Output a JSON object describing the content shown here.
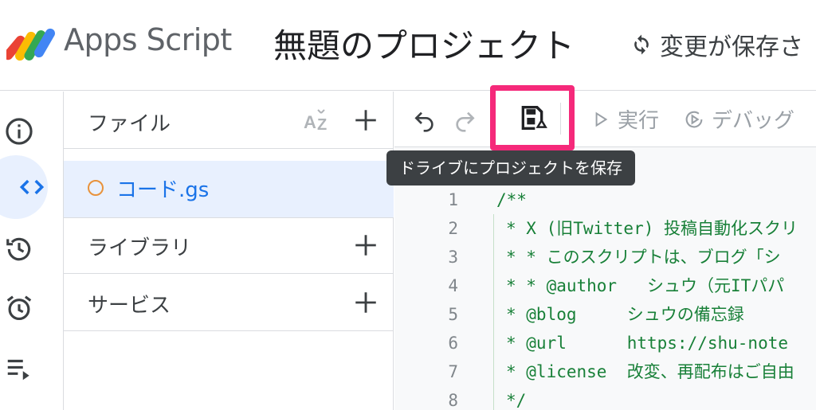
{
  "header": {
    "app_name": "Apps Script",
    "project_title": "無題のプロジェクト",
    "save_status": "変更が保存さ"
  },
  "rail": {
    "items": [
      {
        "icon": "info-icon"
      },
      {
        "icon": "code-icon",
        "active": true
      },
      {
        "icon": "history-icon"
      },
      {
        "icon": "alarm-icon"
      },
      {
        "icon": "executions-icon"
      }
    ]
  },
  "files": {
    "section_label": "ファイル",
    "file_name": "コード.gs",
    "libraries_label": "ライブラリ",
    "services_label": "サービス"
  },
  "toolbar": {
    "run_label": "実行",
    "debug_label": "デバッグ",
    "tooltip": "ドライブにプロジェクトを保存"
  },
  "code": {
    "lines": [
      {
        "n": "1",
        "text": "/**"
      },
      {
        "n": "2",
        "text": "* X (旧Twitter) 投稿自動化スクリ"
      },
      {
        "n": "3",
        "text": "* * このスクリプトは、ブログ「シ"
      },
      {
        "n": "4",
        "text": "* * @author   シュウ（元ITパパ"
      },
      {
        "n": "5",
        "text": "* @blog     シュウの備忘録"
      },
      {
        "n": "6",
        "text": "* @url      https://shu-note"
      },
      {
        "n": "7",
        "text": "* @license  改変、再配布はご自由"
      },
      {
        "n": "8",
        "text": "*/"
      }
    ]
  },
  "colors": {
    "accent": "#1a73e8",
    "highlight": "#f5297a",
    "code_green": "#188038"
  }
}
